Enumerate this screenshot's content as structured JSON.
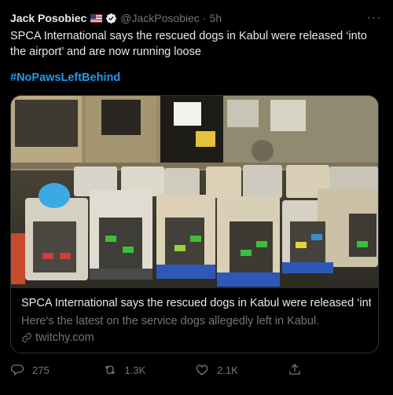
{
  "tweet": {
    "author_name": "Jack Posobiec",
    "handle": "@JackPosobiec",
    "separator": "·",
    "time": "5h",
    "more_label": "···",
    "text": "SPCA International says the rescued dogs in Kabul were released ‘into the airport’ and are now running loose",
    "hashtag": "#NoPawsLeftBehind"
  },
  "card": {
    "title": "SPCA International says the rescued dogs in Kabul were released ‘into...",
    "description": "Here's the latest on the service dogs allegedly left in Kabul.",
    "domain": "twitchy.com"
  },
  "actions": {
    "replies": "275",
    "retweets": "1.3K",
    "likes": "2.1K"
  },
  "colors": {
    "background": "#000000",
    "text": "#e7e9ea",
    "secondary": "#71767b",
    "accent": "#1d9bf0"
  },
  "icons": [
    "verified-icon",
    "flag-us-icon",
    "more-icon",
    "link-icon",
    "reply-icon",
    "retweet-icon",
    "like-icon",
    "share-icon"
  ]
}
